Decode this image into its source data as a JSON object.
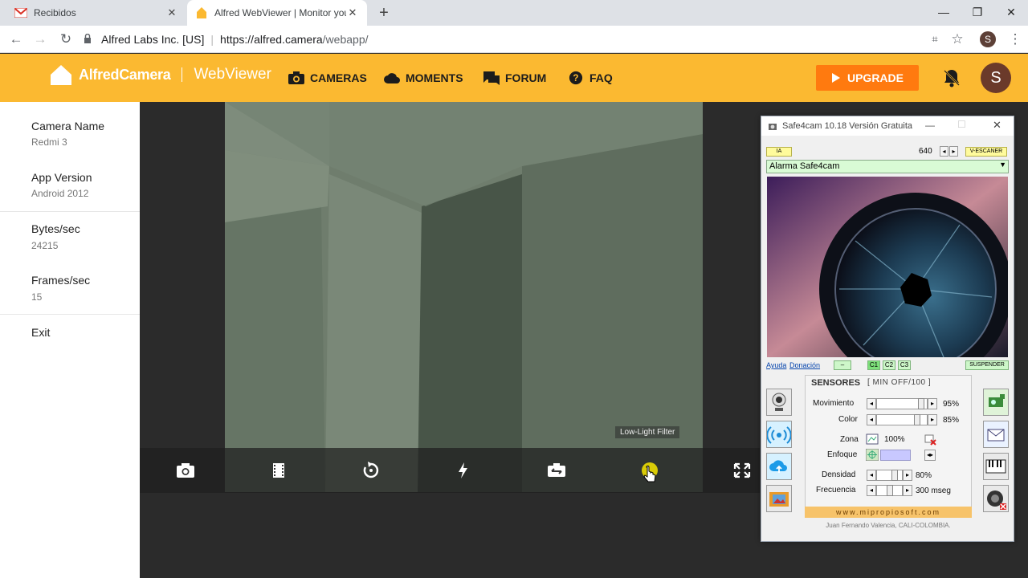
{
  "browser": {
    "tabs": [
      {
        "title": "Recibidos",
        "active": false
      },
      {
        "title": "Alfred WebViewer | Monitor your",
        "active": true
      }
    ],
    "address": {
      "org": "Alfred Labs Inc. [US]",
      "url_host": "https://alfred.camera",
      "url_path": "/webapp/"
    },
    "profile_initial": "S"
  },
  "alfred": {
    "brand": "AlfredCamera",
    "product": "WebViewer",
    "nav": [
      {
        "label": "CAMERAS",
        "icon": "camera-icon"
      },
      {
        "label": "MOMENTS",
        "icon": "cloud-icon"
      },
      {
        "label": "FORUM",
        "icon": "forum-icon"
      },
      {
        "label": "FAQ",
        "icon": "help-icon"
      }
    ],
    "upgrade_label": "UPGRADE",
    "user_initial": "S",
    "accent": "#fbb931",
    "upgrade_color": "#ff7a0f"
  },
  "sidebar": {
    "items": [
      {
        "label": "Camera Name",
        "value": "Redmi 3"
      },
      {
        "label": "App Version",
        "value": "Android 2012"
      },
      {
        "label": "Bytes/sec",
        "value": "24215"
      },
      {
        "label": "Frames/sec",
        "value": "15"
      }
    ],
    "exit_label": "Exit"
  },
  "player": {
    "tooltip": "Low-Light Filter",
    "controls": [
      "snapshot-icon",
      "record-icon",
      "rotate-icon",
      "flash-icon",
      "switch-camera-icon",
      "low-light-icon",
      "fullscreen-icon"
    ]
  },
  "safe4cam": {
    "title": "Safe4cam 10.18 Versión Gratuita",
    "ia_label": "IA",
    "resolution": "640",
    "scanner_label": "V-ESCANER",
    "alarm_select": "Alarma Safe4cam",
    "ayuda": "Ayuda",
    "donacion": "Donación",
    "minus": "–",
    "channels": [
      "C1",
      "C2",
      "C3"
    ],
    "suspend": "SUSPENDER",
    "sensores": "SENSORES",
    "range": "[ MIN OFF/100 ]",
    "sensors": [
      {
        "label": "Movimiento",
        "value": "95%",
        "level": 0.95
      },
      {
        "label": "Color",
        "value": "85%",
        "level": 0.85
      }
    ],
    "zona_label": "Zona",
    "zona_value": "100%",
    "enfoque_label": "Enfoque",
    "densidad_label": "Densidad",
    "densidad_value": "80%",
    "frecuencia_label": "Frecuencia",
    "frecuencia_value": "300 mseg",
    "website": "www.mipropiosoft.com",
    "author": "Juan Fernando Valencia, CALI-COLOMBIA."
  }
}
